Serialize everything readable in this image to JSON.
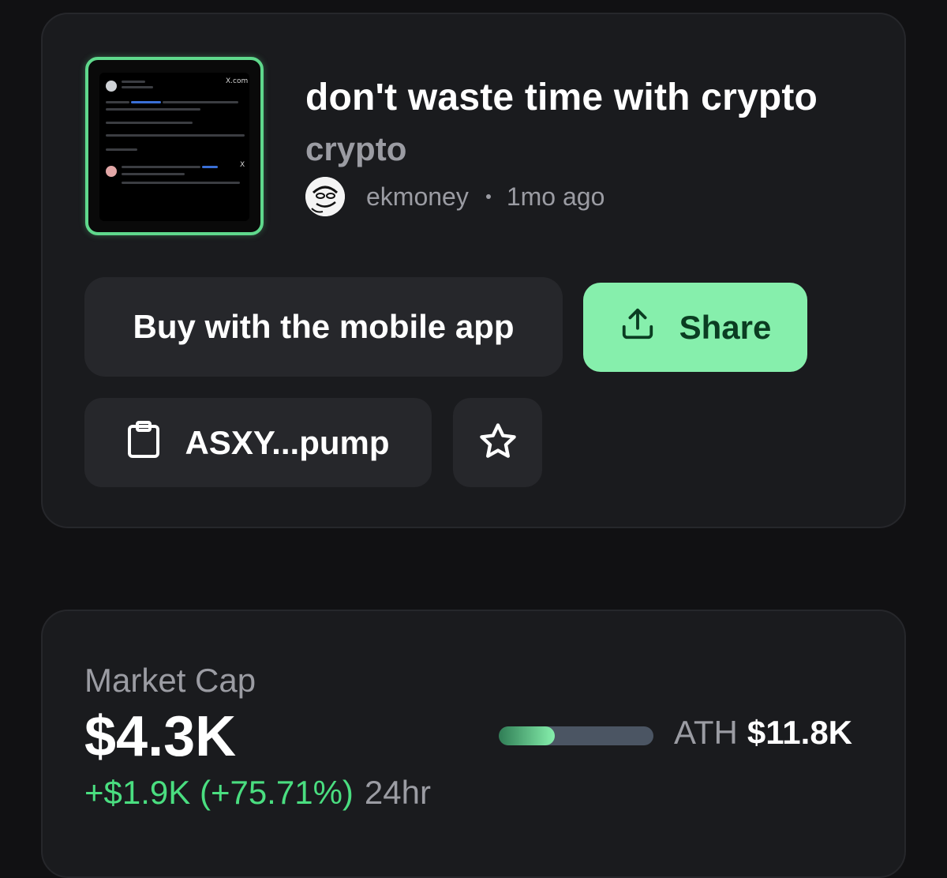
{
  "token": {
    "title": "don't waste time with crypto",
    "ticker": "crypto",
    "creator": "ekmoney",
    "age": "1mo ago",
    "thumbnail_icon": "tweet-screenshot-thumbnail"
  },
  "actions": {
    "buy_label": "Buy with the mobile app",
    "share_label": "Share",
    "share_icon": "upload-share-icon",
    "address_label": "ASXY...pump",
    "address_icon": "clipboard-icon",
    "favorite_icon": "star-icon"
  },
  "market": {
    "label": "Market Cap",
    "value": "$4.3K",
    "change": "+$1.9K (+75.71%)",
    "period": "24hr",
    "ath_label": "ATH",
    "ath_value": "$11.8K",
    "ath_progress_fraction": 0.36
  },
  "colors": {
    "accent": "#86efac",
    "positive": "#4ade80",
    "card_bg": "#1a1b1e",
    "page_bg": "#111113",
    "muted_text": "#9b9ca3"
  }
}
